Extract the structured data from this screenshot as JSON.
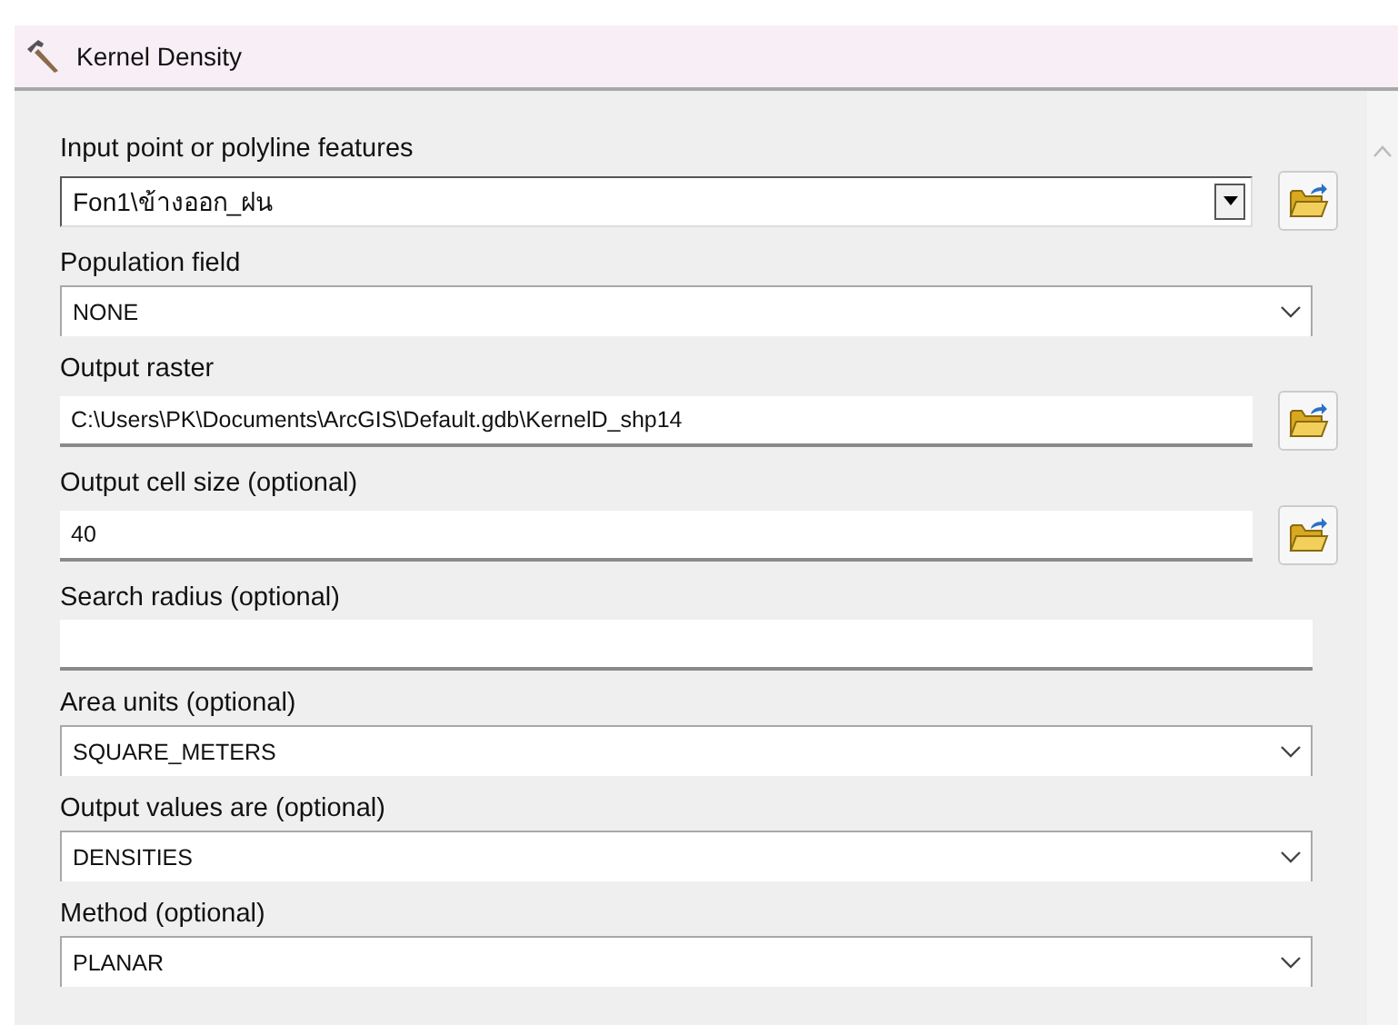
{
  "window": {
    "title": "Kernel Density"
  },
  "fields": [
    {
      "label": "Input point or polyline features",
      "kind": "classic-combo",
      "value": "Fon1\\ข้างออก_ฝน",
      "browse": true
    },
    {
      "label": "Population field",
      "kind": "combo",
      "value": "NONE",
      "browse": false
    },
    {
      "label": "Output raster",
      "kind": "text",
      "value": "C:\\Users\\PK\\Documents\\ArcGIS\\Default.gdb\\KernelD_shp14",
      "browse": true
    },
    {
      "label": "Output cell size (optional)",
      "kind": "text",
      "value": "40",
      "browse": true
    },
    {
      "label": "Search radius (optional)",
      "kind": "text",
      "browse": false
    },
    {
      "label": "Area units (optional)",
      "kind": "combo",
      "value": "SQUARE_METERS",
      "browse": false
    },
    {
      "label": "Output values are (optional)",
      "kind": "combo",
      "value": "DENSITIES",
      "browse": false
    },
    {
      "label": "Method (optional)",
      "kind": "combo",
      "value": "PLANAR",
      "browse": false
    }
  ]
}
